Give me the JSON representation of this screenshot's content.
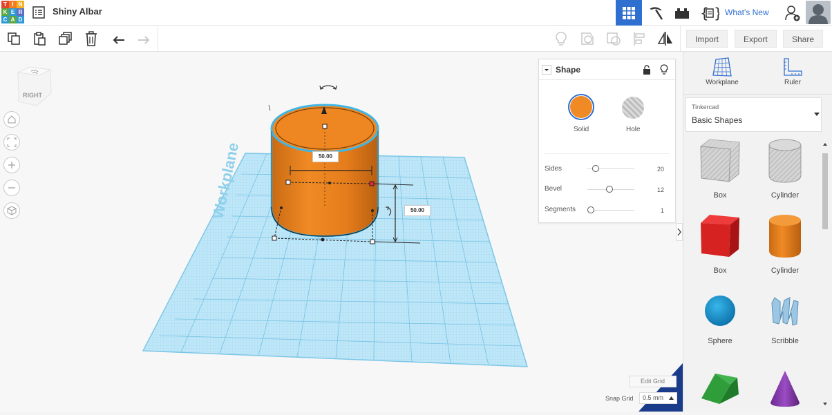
{
  "app": {
    "logo_letters": [
      "T",
      "I",
      "N",
      "K",
      "E",
      "R",
      "C",
      "A",
      "D"
    ],
    "logo_colors": [
      "#e2442e",
      "#f27c21",
      "#f7b12a",
      "#5aa83f",
      "#2e9bd6",
      "#5c6fc4",
      "#2e9bd6",
      "#5aa83f",
      "#2e9bd6"
    ],
    "project_title": "Shiny Albar",
    "whats_new": "What's New",
    "accent": "#2f6fcf"
  },
  "toolbar": {
    "import_label": "Import",
    "export_label": "Export",
    "share_label": "Share"
  },
  "viewcube": {
    "face_label": "RIGHT"
  },
  "workplane": {
    "label": "Workplane",
    "color": "#a9dff5"
  },
  "cylinder": {
    "color": "#f08a24",
    "width_value": "50.00",
    "height_value": "50.00"
  },
  "shape_panel": {
    "title": "Shape",
    "solid_label": "Solid",
    "hole_label": "Hole",
    "solid_color": "#f08a24",
    "params": [
      {
        "label": "Sides",
        "value": "20",
        "fraction": 0.12
      },
      {
        "label": "Bevel",
        "value": "12",
        "fraction": 0.46
      },
      {
        "label": "Segments",
        "value": "1",
        "fraction": 0.0
      }
    ]
  },
  "sidebar": {
    "workplane_label": "Workplane",
    "ruler_label": "Ruler",
    "library_owner": "Tinkercad",
    "library_name": "Basic Shapes",
    "shapes": [
      {
        "label": "Box",
        "icon": "box-hole-icon"
      },
      {
        "label": "Cylinder",
        "icon": "cylinder-hole-icon"
      },
      {
        "label": "Box",
        "icon": "box-icon"
      },
      {
        "label": "Cylinder",
        "icon": "cylinder-icon"
      },
      {
        "label": "Sphere",
        "icon": "sphere-icon"
      },
      {
        "label": "Scribble",
        "icon": "scribble-icon"
      },
      {
        "label": "",
        "icon": "roof-icon"
      },
      {
        "label": "",
        "icon": "cone-icon"
      }
    ]
  },
  "grid": {
    "edit_label": "Edit Grid",
    "snap_label": "Snap Grid",
    "snap_value": "0.5 mm"
  }
}
